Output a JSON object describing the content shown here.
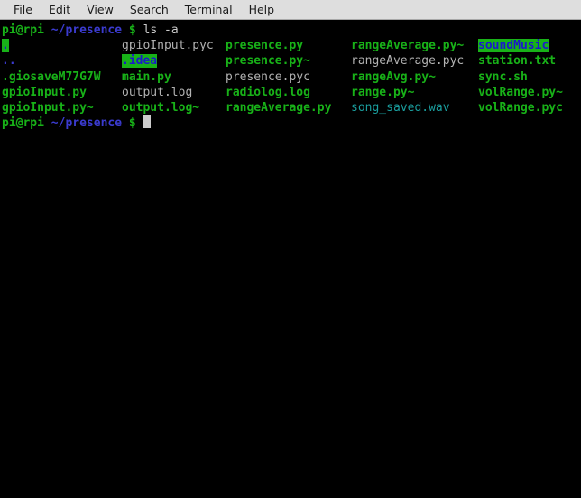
{
  "window": {
    "title": "Terminal"
  },
  "menubar": {
    "items": [
      {
        "label": "File",
        "name": "menu-file"
      },
      {
        "label": "Edit",
        "name": "menu-edit"
      },
      {
        "label": "View",
        "name": "menu-view"
      },
      {
        "label": "Search",
        "name": "menu-search"
      },
      {
        "label": "Terminal",
        "name": "menu-terminal"
      },
      {
        "label": "Help",
        "name": "menu-help"
      }
    ]
  },
  "colors": {
    "menubar_bg": "#dedede",
    "menubar_fg": "#1a1a1a",
    "terminal_bg": "#000000",
    "text_default": "#cccccc",
    "green": "#18b218",
    "green_bright": "#23d318",
    "blue": "#3b3bd0",
    "cyan": "#1a9e9e",
    "gray": "#b2b2b2",
    "dir_highlight_bg": "#18b218",
    "dir_highlight_fg": "#1a1acc",
    "cursor": "#cccccc"
  },
  "prompt": {
    "user_host": "pi@rpi",
    "path": "~/presence",
    "symbol": "$"
  },
  "command_line": {
    "command": "ls -a"
  },
  "listing": {
    "rows": [
      {
        "cells": [
          {
            "text": ".",
            "style": "dir-highlight"
          },
          {
            "text": "gpioInput.pyc",
            "style": "gray"
          },
          {
            "text": "presence.py",
            "style": "green"
          },
          {
            "text": "rangeAverage.py~",
            "style": "green"
          },
          {
            "text": "soundMusic",
            "style": "dir-highlight"
          }
        ]
      },
      {
        "cells": [
          {
            "text": "..",
            "style": "blue"
          },
          {
            "text": ".idea",
            "style": "dir-highlight"
          },
          {
            "text": "presence.py~",
            "style": "green"
          },
          {
            "text": "rangeAverage.pyc",
            "style": "gray"
          },
          {
            "text": "station.txt",
            "style": "green"
          }
        ]
      },
      {
        "cells": [
          {
            "text": ".giosaveM77G7W",
            "style": "green"
          },
          {
            "text": "main.py",
            "style": "green"
          },
          {
            "text": "presence.pyc",
            "style": "gray"
          },
          {
            "text": "rangeAvg.py~",
            "style": "green"
          },
          {
            "text": "sync.sh",
            "style": "green"
          }
        ]
      },
      {
        "cells": [
          {
            "text": "gpioInput.py",
            "style": "green"
          },
          {
            "text": "output.log",
            "style": "gray"
          },
          {
            "text": "radiolog.log",
            "style": "green"
          },
          {
            "text": "range.py~",
            "style": "green"
          },
          {
            "text": "volRange.py~",
            "style": "green"
          }
        ]
      },
      {
        "cells": [
          {
            "text": "gpioInput.py~",
            "style": "green"
          },
          {
            "text": "output.log~",
            "style": "green"
          },
          {
            "text": "rangeAverage.py",
            "style": "green"
          },
          {
            "text": "song_saved.wav",
            "style": "cyan"
          },
          {
            "text": "volRange.pyc",
            "style": "green"
          }
        ]
      }
    ]
  }
}
